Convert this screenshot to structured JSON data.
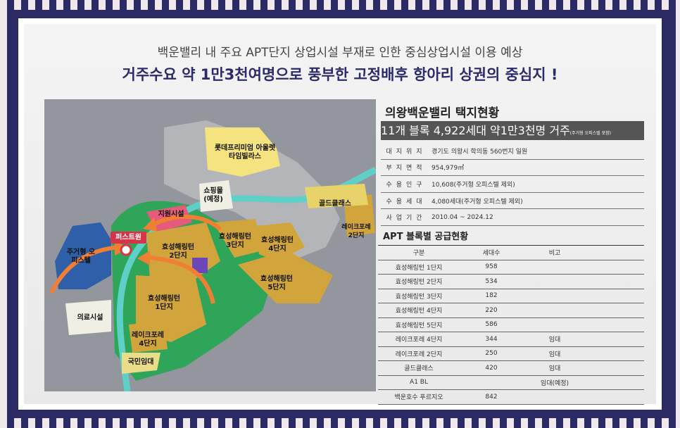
{
  "headline": {
    "line1": "백운밸리 내 주요 APT단지 상업시설 부재로 인한 중심상업시설 이용 예상",
    "line2": "거주수요 약 1만3천여명으로 풍부한 고정배후 항아리 상권의 중심지 !"
  },
  "map": {
    "labels": {
      "lotte": "롯데프리미엄 아울렛\n타임빌라스",
      "shopping": "쇼핑몰\n(예정)",
      "support": "지원시설",
      "goldclass": "골드클래스",
      "lakeforet2": "레이크포레\n2단지",
      "hs3": "효성해링턴\n3단지",
      "hs4": "효성해링턴\n4단지",
      "hs2": "효성해링턴\n2단지",
      "hs5": "효성해링턴\n5단지",
      "hs1": "효성해링턴\n1단지",
      "lakeforet4": "레이크포레\n4단지",
      "national": "국민임대",
      "medical": "의료시설",
      "residential": "주거형 오\n피스텔",
      "flag": "퍼스트원"
    }
  },
  "summary": {
    "title": "의왕백운밸리 택지현황",
    "banner_main": "11개 블록 4,922세대 약1만3천명 거주",
    "banner_note": "(주거형 오피스텔 포함)",
    "rows": [
      {
        "key": "대지위지",
        "value": "경기도 의왕시 학의동 560번지 일원"
      },
      {
        "key": "부지면적",
        "value": "954,979㎡"
      },
      {
        "key": "수용인구",
        "value": "10,608(주거형 오피스텔 제외)"
      },
      {
        "key": "수용세대",
        "value": "4,080세대(주거형 오피스텔 제외)"
      },
      {
        "key": "사업기간",
        "value": "2010.04 ~ 2024.12"
      }
    ]
  },
  "supply": {
    "title": "APT 블록별 공급현황",
    "headers": [
      "구분",
      "세대수",
      "비고"
    ],
    "rows": [
      [
        "효성해링턴 1단지",
        "958",
        ""
      ],
      [
        "효성해링턴 2단지",
        "534",
        ""
      ],
      [
        "효성해링턴 3단지",
        "182",
        ""
      ],
      [
        "효성해링턴 4단지",
        "220",
        ""
      ],
      [
        "효성해링턴 5단지",
        "586",
        ""
      ],
      [
        "레이크포레 4단지",
        "344",
        "임대"
      ],
      [
        "레이크포레 2단지",
        "250",
        "임대"
      ],
      [
        "골드클래스",
        "420",
        "임대"
      ],
      [
        "A1 BL",
        "",
        "임대(예정)"
      ],
      [
        "백운호수 푸르지오",
        "842",
        ""
      ]
    ]
  }
}
